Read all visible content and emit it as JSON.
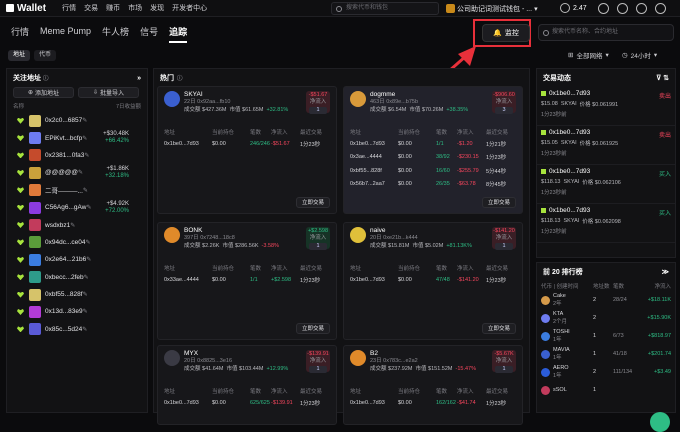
{
  "top": {
    "logo": "Wallet",
    "nav": [
      "行情",
      "交易",
      "赚币",
      "市场",
      "发现",
      "开发者中心"
    ],
    "search_placeholder": "搜索代币和钱包",
    "account": "公司助记词测试钱包 - ...",
    "balance": "2.47"
  },
  "sub": {
    "tabs": [
      "行情",
      "Meme Pump",
      "牛人榜",
      "信号",
      "追踪"
    ],
    "monitor": "监控",
    "search_placeholder": "搜索代币名称、合约地址"
  },
  "filters": {
    "pill_addr": "地址",
    "pill_token": "代币",
    "network": "全部网络",
    "range": "24小时"
  },
  "watch": {
    "title": "关注地址",
    "add": "添加地址",
    "import": "批量导入",
    "col_name": "名称",
    "col_pnl": "7日收益额",
    "rows": [
      {
        "name": "0x2c0...6857",
        "v1": "",
        "v2": "",
        "c": "#d6c36a"
      },
      {
        "name": "EPiKvt...bcfp",
        "v1": "+$30.48K",
        "v2": "+66.42%",
        "c": "#6e7cf0"
      },
      {
        "name": "0x2381...0fa3",
        "v1": "",
        "v2": "",
        "c": "#c54b2c"
      },
      {
        "name": "@@@@@",
        "v1": "+$1.86K",
        "v2": "+32.18%",
        "c": "#c9a13b"
      },
      {
        "name": "二哥———...",
        "v1": "",
        "v2": "",
        "c": "#e07a3a"
      },
      {
        "name": "C56Ag6...gAw",
        "v1": "+$4.92K",
        "v2": "+72.00%",
        "c": "#8c3be0"
      },
      {
        "name": "wsdxbz1",
        "v1": "",
        "v2": "",
        "c": "#c23b5c"
      },
      {
        "name": "0x94dc...ce04",
        "v1": "",
        "v2": "",
        "c": "#5b9c3a"
      },
      {
        "name": "0x2e64...21b6",
        "v1": "",
        "v2": "",
        "c": "#3b7de0"
      },
      {
        "name": "0xbecc...2feb",
        "v1": "",
        "v2": "",
        "c": "#2e9b8a"
      },
      {
        "name": "0xbf55...828f",
        "v1": "",
        "v2": "",
        "c": "#d6c36a"
      },
      {
        "name": "0x13d...83e9",
        "v1": "",
        "v2": "",
        "c": "#b23bd6"
      },
      {
        "name": "0x85c...5d24",
        "v1": "",
        "v2": "",
        "c": "#5a5ad6"
      }
    ]
  },
  "hot": {
    "title": "热门",
    "cols": [
      "地址",
      "当前持仓",
      "笔数",
      "净流入",
      "最近交易"
    ],
    "quick": "立即交易",
    "cards": [
      {
        "name": "SKYAI",
        "meta": "22日 0x92aa...fb10",
        "stat1": "成交额 $427.36M",
        "stat2": "市值 $61.65M",
        "pct": "+32.81%",
        "b1": "-$51.67",
        "b2": "净流入",
        "b3": "1",
        "bc": "r",
        "c": "#3a5fcf",
        "rows": [
          {
            "a": "0x1be0...7d93",
            "h": "$0.00",
            "n": "246/246",
            "f": "-$51.67",
            "t": "1分23秒"
          }
        ]
      },
      {
        "name": "dogmme",
        "meta": "463日 0x89e...b75b",
        "stat1": "成交额 $6.54M",
        "stat2": "市值 $70.26M",
        "pct": "+38.35%",
        "b1": "-$906.60",
        "b2": "净流入",
        "b3": "3",
        "bc": "r",
        "c": "#d99a3a",
        "rows": [
          {
            "a": "0x1be0...7d93",
            "h": "$0.00",
            "n": "1/1",
            "f": "-$1.20",
            "t": "1分21秒"
          },
          {
            "a": "0x3ae...4444",
            "h": "$0.00",
            "n": "38/92",
            "f": "-$230.15",
            "t": "1分23秒"
          },
          {
            "a": "0xbf55...828f",
            "h": "$0.00",
            "n": "16/60",
            "f": "-$255.79",
            "t": "5分44秒"
          },
          {
            "a": "0x56b7...2aa7",
            "h": "$0.00",
            "n": "26/35",
            "f": "-$63.78",
            "t": "8分45秒"
          }
        ]
      },
      {
        "name": "BONK",
        "meta": "397日 0x7248...18c8",
        "stat1": "成交额 $2.26K",
        "stat2": "市值 $286.56K",
        "pct": "-3.58%",
        "b1": "+$2.598",
        "b2": "净流入",
        "b3": "1",
        "bc": "g",
        "c": "#e08a2a",
        "rows": [
          {
            "a": "0x33ae...4444",
            "h": "$0.00",
            "n": "1/1",
            "f": "+$2.598",
            "t": "1分23秒"
          }
        ]
      },
      {
        "name": "naive",
        "meta": "20日 0xe21b...k444",
        "stat1": "成交额 $15.81M",
        "stat2": "市值 $5.02M",
        "pct": "+81.13K%",
        "b1": "-$141.20",
        "b2": "净流入",
        "b3": "1",
        "bc": "r",
        "c": "#e0c03a",
        "rows": [
          {
            "a": "0x1be0...7d93",
            "h": "$0.00",
            "n": "47/48",
            "f": "-$141.20",
            "t": "1分23秒"
          }
        ]
      },
      {
        "name": "MYX",
        "meta": "20日 0x8825...3e16",
        "stat1": "成交额 $41.64M",
        "stat2": "市值 $103.44M",
        "pct": "+12.99%",
        "b1": "-$139.91",
        "b2": "净流入",
        "b3": "1",
        "bc": "r",
        "c": "#3a3a44",
        "rows": [
          {
            "a": "0x1be0...7d93",
            "h": "$0.00",
            "n": "625/625",
            "f": "-$139.91",
            "t": "1分23秒"
          }
        ]
      },
      {
        "name": "B2",
        "meta": "23日 0x783c...e2a2",
        "stat1": "成交额 $237.92M",
        "stat2": "市值 $151.52M",
        "pct": "-15.47%",
        "b1": "-$5.67K",
        "b2": "净流入",
        "b3": "1",
        "bc": "r",
        "c": "#e08a2a",
        "rows": [
          {
            "a": "0x1be0...7d93",
            "h": "$0.00",
            "n": "162/162",
            "f": "-$41.74",
            "t": "1分23秒"
          }
        ]
      }
    ]
  },
  "trades": {
    "title": "交易动态",
    "items": [
      {
        "addr": "0x1be0...7d93",
        "side": "卖出",
        "sc": "red",
        "amt": "$15.08",
        "tok": "SKYAI",
        "price": "价格 $0.061991",
        "time": "1分23秒前"
      },
      {
        "addr": "0x1be0...7d93",
        "side": "卖出",
        "sc": "red",
        "amt": "$15.05",
        "tok": "SKYAI",
        "price": "价格 $0.061925",
        "time": "1分23秒前"
      },
      {
        "addr": "0x1be0...7d93",
        "side": "买入",
        "sc": "green",
        "amt": "$118.13",
        "tok": "SKYAI",
        "price": "价格 $0.062106",
        "time": "1分23秒前"
      },
      {
        "addr": "0x1be0...7d93",
        "side": "买入",
        "sc": "green",
        "amt": "$118.13",
        "tok": "SKYAI",
        "price": "价格 $0.062098",
        "time": "1分23秒前"
      }
    ]
  },
  "top20": {
    "title": "前 20 排行榜",
    "cols": [
      "代币 | 创建时间",
      "地址数",
      "笔数",
      "净流入"
    ],
    "rows": [
      {
        "n": "Cake",
        "d": "2年",
        "a": "2",
        "b": "28/24",
        "f": "+$18.11K",
        "c": "#d59a4a"
      },
      {
        "n": "KTA",
        "d": "2个月",
        "a": "2",
        "b": "",
        "f": "+$15.90K",
        "c": "#6e7cf0"
      },
      {
        "n": "TOSHI",
        "d": "1年",
        "a": "1",
        "b": "6/73",
        "f": "+$818.97",
        "c": "#3b7de0"
      },
      {
        "n": "MAVIA",
        "d": "1年",
        "a": "1",
        "b": "41/18",
        "f": "+$201.74",
        "c": "#3a5fcf"
      },
      {
        "n": "AERO",
        "d": "1年",
        "a": "2",
        "b": "111/134",
        "f": "+$3.49",
        "c": "#2b5cd9"
      },
      {
        "n": "sSOL",
        "d": "",
        "a": "1",
        "b": "",
        "f": "",
        "c": "#c23b5c"
      }
    ]
  }
}
